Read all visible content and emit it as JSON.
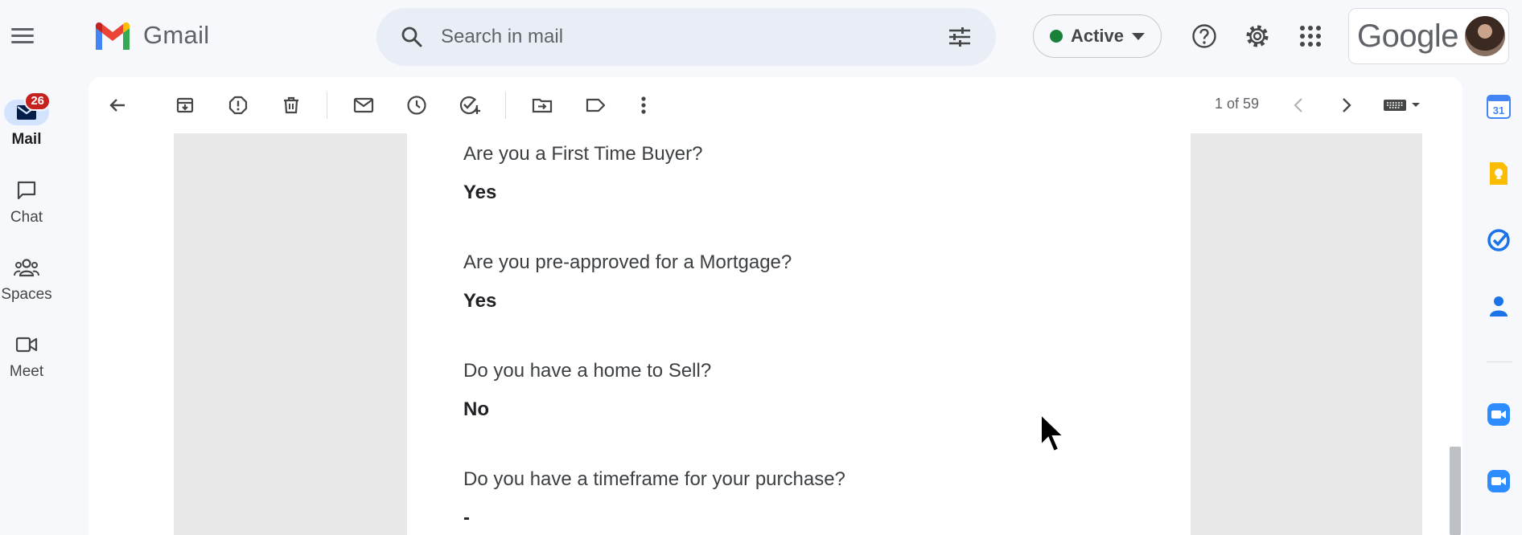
{
  "app": {
    "name": "Gmail",
    "google_word": "Google"
  },
  "nav": {
    "items": [
      {
        "label": "Mail",
        "badge": "26",
        "icon": "mail-icon"
      },
      {
        "label": "Chat",
        "icon": "chat-icon"
      },
      {
        "label": "Spaces",
        "icon": "spaces-icon"
      },
      {
        "label": "Meet",
        "icon": "meet-icon"
      }
    ]
  },
  "search": {
    "placeholder": "Search in mail"
  },
  "status": {
    "label": "Active",
    "color": "#188038"
  },
  "toolbar": {
    "pager": "1 of 59"
  },
  "email": {
    "questions": [
      {
        "q": "Are you a First Time Buyer?",
        "a": "Yes"
      },
      {
        "q": "Are you pre-approved for a Mortgage?",
        "a": "Yes"
      },
      {
        "q": "Do you have a home to Sell?",
        "a": "No"
      },
      {
        "q": "Do you have a timeframe for your purchase?",
        "a": "-"
      }
    ]
  },
  "side_panel": {
    "calendar_day": "31",
    "apps": [
      "calendar-icon",
      "keep-icon",
      "tasks-icon",
      "contacts-icon",
      "zoom-icon",
      "zoom-icon"
    ]
  },
  "colors": {
    "accent": "#0b57d0",
    "badge": "#c5221f",
    "nav_active": "#d3e3fd"
  }
}
